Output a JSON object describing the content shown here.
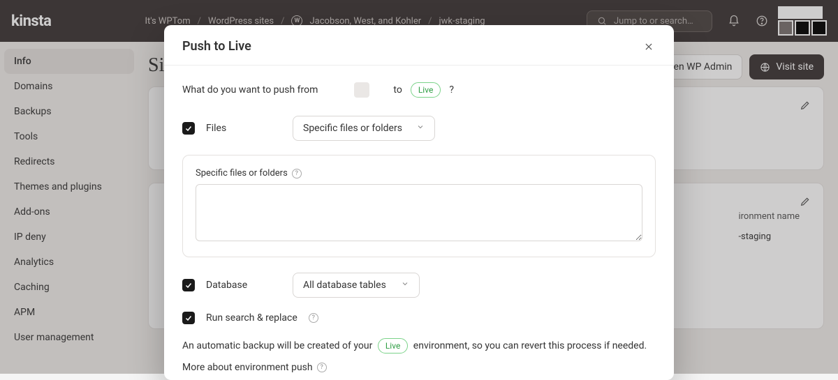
{
  "topbar": {
    "brand": "kinsta",
    "crumbs": {
      "org": "It's WPTom",
      "section": "WordPress sites",
      "site": "Jacobson, West, and Kohler",
      "env": "jwk-staging"
    },
    "search_placeholder": "Jump to or search…"
  },
  "sidebar": {
    "items": [
      {
        "label": "Info",
        "active": true
      },
      {
        "label": "Domains"
      },
      {
        "label": "Backups"
      },
      {
        "label": "Tools"
      },
      {
        "label": "Redirects"
      },
      {
        "label": "Themes and plugins"
      },
      {
        "label": "Add-ons"
      },
      {
        "label": "IP deny"
      },
      {
        "label": "Analytics"
      },
      {
        "label": "Caching"
      },
      {
        "label": "APM"
      },
      {
        "label": "User management"
      }
    ]
  },
  "content": {
    "page_title": "Si",
    "open_wp_admin": "Open WP Admin",
    "visit_site": "Visit site",
    "env_name_label": "ironment name",
    "env_name_value": "-staging"
  },
  "modal": {
    "title": "Push to Live",
    "question_prefix": "What do you want to push from",
    "to_word": "to",
    "live_chip": "Live",
    "qmark": "?",
    "files": {
      "label": "Files",
      "select": "Specific files or folders",
      "field_label": "Specific files or folders",
      "field_value": ""
    },
    "database": {
      "label": "Database",
      "select": "All database tables"
    },
    "search_replace": {
      "label": "Run search & replace"
    },
    "backup_note_before": "An automatic backup will be created of your",
    "backup_note_after": "environment, so you can revert this process if needed.",
    "more_link": "More about environment push"
  }
}
